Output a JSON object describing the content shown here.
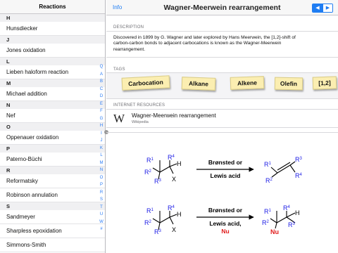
{
  "sidebar": {
    "title": "Reactions",
    "rows": [
      {
        "type": "section",
        "text": "H"
      },
      {
        "type": "item",
        "text": "Hunsdiecker"
      },
      {
        "type": "section",
        "text": "J"
      },
      {
        "type": "item",
        "text": "Jones oxidation"
      },
      {
        "type": "section",
        "text": "L"
      },
      {
        "type": "item",
        "text": "Lieben haloform reaction"
      },
      {
        "type": "section",
        "text": "M"
      },
      {
        "type": "item",
        "text": "Michael addition"
      },
      {
        "type": "section",
        "text": "N"
      },
      {
        "type": "item",
        "text": "Nef"
      },
      {
        "type": "section",
        "text": "O"
      },
      {
        "type": "item",
        "text": "Oppenauer oxidation"
      },
      {
        "type": "section",
        "text": "P"
      },
      {
        "type": "item",
        "text": "Paterno-Büchi"
      },
      {
        "type": "section",
        "text": "R"
      },
      {
        "type": "item",
        "text": "Reformatsky"
      },
      {
        "type": "item",
        "text": "Robinson annulation"
      },
      {
        "type": "section",
        "text": "S"
      },
      {
        "type": "item",
        "text": "Sandmeyer"
      },
      {
        "type": "item",
        "text": "Sharpless epoxidation"
      },
      {
        "type": "item",
        "text": "Simmons-Smith"
      }
    ],
    "index": [
      "Q",
      "A",
      "B",
      "C",
      "D",
      "E",
      "F",
      "G",
      "H",
      "I",
      "J",
      "K",
      "L",
      "M",
      "N",
      "O",
      "P",
      "R",
      "S",
      "T",
      "U",
      "W",
      "#"
    ]
  },
  "navbar": {
    "info_label": "Info",
    "title": "Wagner-Meerwein rearrangement",
    "prev_icon": "left-triangle-icon",
    "next_icon": "right-triangle-icon"
  },
  "description": {
    "label": "DESCRIPTION",
    "lines": [
      "Discovered in 1899 by G. Wagner and later explored by Hans Meerwein, the [1,2]-shift of",
      "carbon-carbon bonds to adjacent carbocations is known as the Wagner-Meerwein",
      "rearrangement."
    ]
  },
  "tags": {
    "label": "TAGS",
    "items": [
      "Carbocation",
      "Alkane",
      "Alkene",
      "Olefin",
      "[1,2]"
    ]
  },
  "resources": {
    "label": "INTERNET RESOURCES",
    "icon": "wikipedia-w-icon",
    "title": "Wagner-Meerwein rearrangement",
    "source": "Wikipedia"
  },
  "scheme": {
    "reactions": [
      {
        "reactant": [
          "R",
          "1",
          "R",
          "2",
          "R",
          "3",
          "R",
          "4",
          "H",
          "X"
        ],
        "conditions": [
          "Brønsted or",
          "Lewis acid"
        ],
        "product": [
          "R",
          "1",
          "R",
          "2",
          "R",
          "3",
          "R",
          "4"
        ]
      },
      {
        "reactant": [
          "R",
          "1",
          "R",
          "2",
          "R",
          "3",
          "R",
          "4",
          "H",
          "X"
        ],
        "conditions": [
          "Brønsted or",
          "Lewis acid,",
          "Nu"
        ],
        "product": [
          "R",
          "1",
          "R",
          "2",
          "R",
          "3",
          "R",
          "4",
          "H",
          "Nu"
        ]
      }
    ],
    "colors": {
      "substituent": "#1a1ae6",
      "bond": "#000000",
      "nucleophile": "#e01b1b"
    }
  }
}
